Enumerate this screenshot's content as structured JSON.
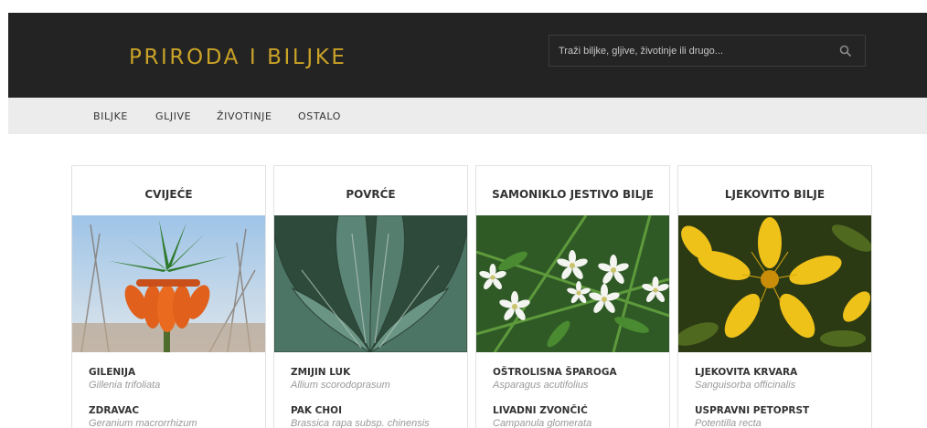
{
  "header": {
    "logo": "PRIRODA I BILJKE",
    "search_placeholder": "Traži biljke, gljive, životinje ili drugo...",
    "search_icon": "search-icon"
  },
  "nav": {
    "items": [
      {
        "label": "BILJKE"
      },
      {
        "label": "GLJIVE"
      },
      {
        "label": "ŽIVOTINJE"
      },
      {
        "label": "OSTALO"
      }
    ]
  },
  "categories": [
    {
      "title": "CVIJEĆE",
      "image": "fritillaria-flower-photo",
      "entries": [
        {
          "name": "GILENIJA",
          "latin": "Gillenia trifoliata"
        },
        {
          "name": "ZDRAVAC",
          "latin": "Geranium macrorrhizum"
        }
      ]
    },
    {
      "title": "POVRĆE",
      "image": "kale-leaves-photo",
      "entries": [
        {
          "name": "ZMIJIN LUK",
          "latin": "Allium scorodoprasum"
        },
        {
          "name": "PAK CHOI",
          "latin": "Brassica rapa subsp. chinensis"
        }
      ]
    },
    {
      "title": "SAMONIKLO JESTIVO BILJE",
      "image": "stellaria-white-flowers-photo",
      "entries": [
        {
          "name": "OŠTROLISNA ŠPAROGA",
          "latin": "Asparagus acutifolius"
        },
        {
          "name": "LIVADNI ZVONČIĆ",
          "latin": "Campanula glomerata"
        }
      ]
    },
    {
      "title": "LJEKOVITO BILJE",
      "image": "hypericum-yellow-flower-photo",
      "entries": [
        {
          "name": "LJEKOVITA KRVARA",
          "latin": "Sanguisorba officinalis"
        },
        {
          "name": "USPRAVNI PETOPRST",
          "latin": "Potentilla recta"
        }
      ]
    }
  ]
}
